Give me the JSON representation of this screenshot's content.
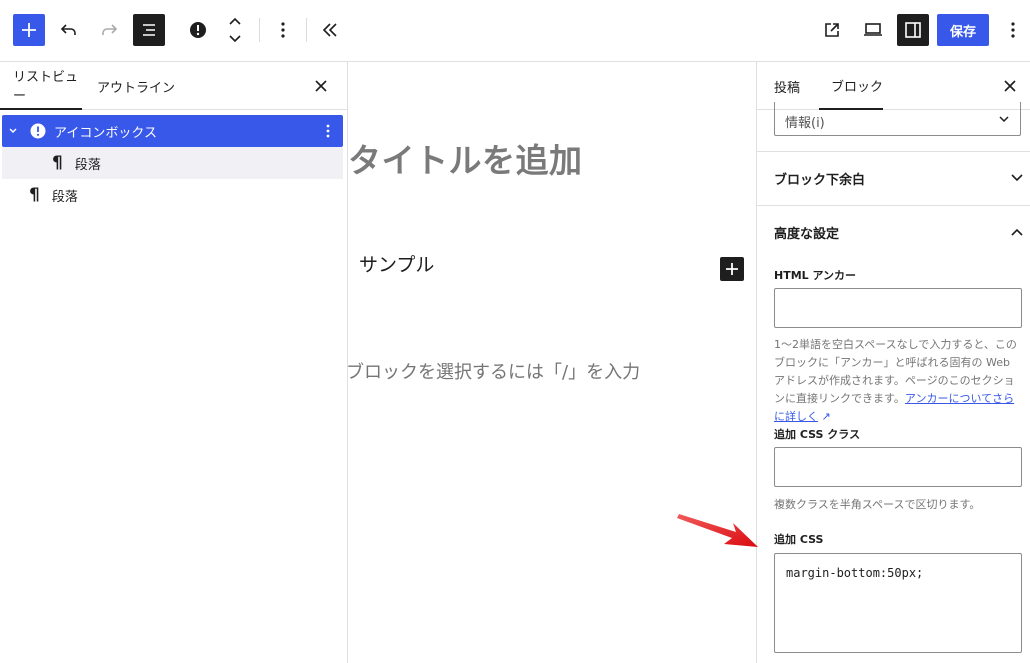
{
  "toolbar": {
    "add_block_icon": "plus-icon",
    "undo_icon": "undo-icon",
    "redo_icon": "redo-icon",
    "list_view_icon": "list-view-icon",
    "block_icon": "exclamation-circle-icon",
    "move_icon": "move-up-down-icon",
    "options_icon": "more-vertical-icon",
    "collapse_icon": "chevron-double-left-icon",
    "view_icon": "external-link-icon",
    "preview_icon": "desktop-icon",
    "settings_icon": "sidebar-icon",
    "save_label": "保存",
    "more_icon": "more-vertical-icon"
  },
  "left_panel": {
    "tabs": [
      {
        "label": "リストビュー",
        "active": true
      },
      {
        "label": "アウトライン",
        "active": false
      }
    ],
    "items": [
      {
        "label": "アイコンボックス",
        "icon": "exclamation-circle-icon",
        "level": 0,
        "selected": true
      },
      {
        "label": "段落",
        "icon": "paragraph-icon",
        "level": 1,
        "selected": false
      },
      {
        "label": "段落",
        "icon": "paragraph-icon",
        "level": 0,
        "selected": false
      }
    ]
  },
  "canvas": {
    "title_placeholder": "タイトルを追加",
    "sample_text": "サンプル",
    "block_placeholder": "ブロックを選択するには「/」を入力"
  },
  "right_panel": {
    "tabs": [
      {
        "label": "投稿",
        "active": false
      },
      {
        "label": "ブロック",
        "active": true
      }
    ],
    "select_value": "情報(i)",
    "section_margin": "ブロック下余白",
    "section_advanced": "高度な設定",
    "html_anchor_label": "HTML アンカー",
    "anchor_help": "1〜2単語を空白スペースなしで入力すると、このブロックに「アンカー」と呼ばれる固有の Web アドレスが作成されます。ページのこのセクションに直接リンクできます。",
    "anchor_link": "アンカーについてさらに詳しく",
    "css_class_label": "追加 CSS クラス",
    "css_class_help": "複数クラスを半角スペースで区切ります。",
    "css_label": "追加 CSS",
    "css_value": "margin-bottom:50px;"
  },
  "colors": {
    "accent": "#3858e9",
    "annotation_arrow": "#e8141c"
  }
}
